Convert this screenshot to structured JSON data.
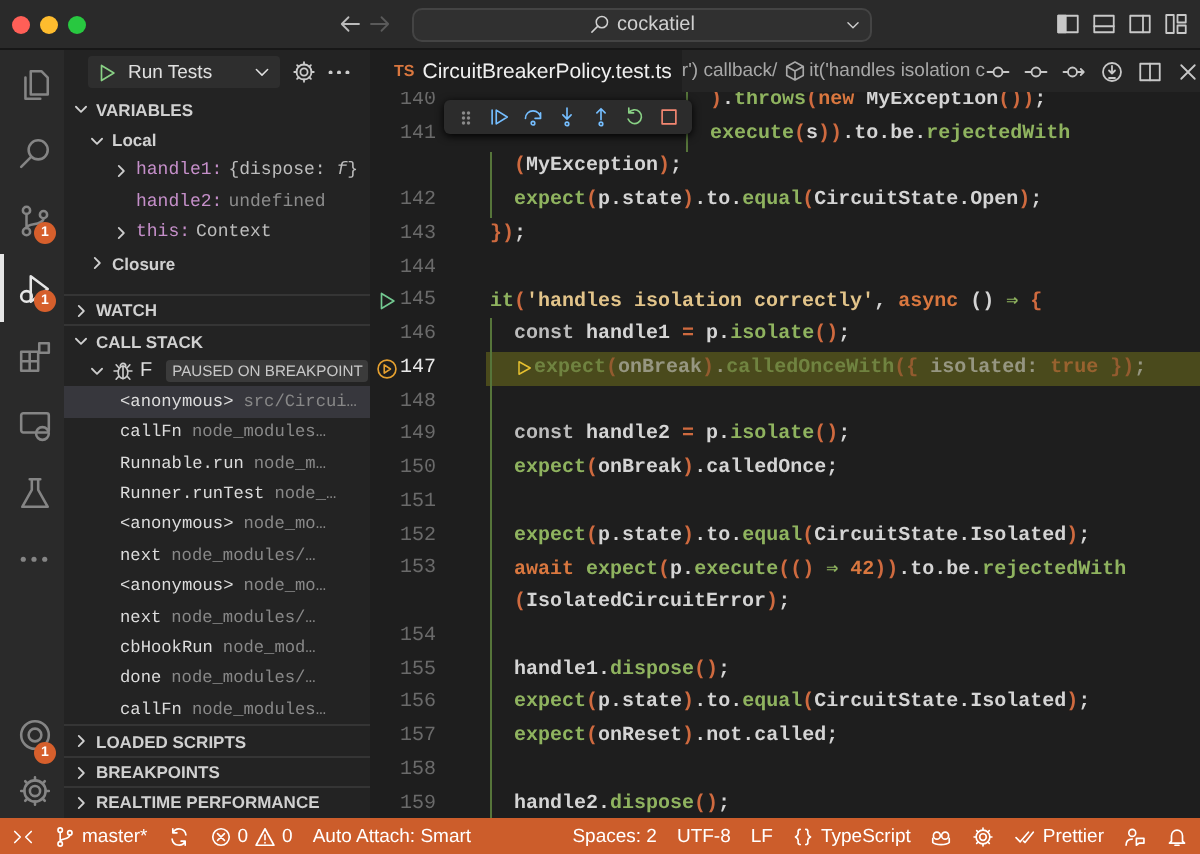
{
  "window": {
    "title": "cockatiel"
  },
  "activity_bar": {
    "items": [
      {
        "kind": "explorer",
        "selected": false
      },
      {
        "kind": "search",
        "selected": false
      },
      {
        "kind": "source-control",
        "selected": false,
        "badge": "1"
      },
      {
        "kind": "run-debug",
        "selected": true,
        "badge": "1"
      },
      {
        "kind": "extensions",
        "selected": false
      },
      {
        "kind": "remote",
        "selected": false
      },
      {
        "kind": "testing",
        "selected": false
      },
      {
        "kind": "more",
        "selected": false
      }
    ],
    "bottom": [
      {
        "kind": "accounts",
        "badge": "1"
      },
      {
        "kind": "settings"
      }
    ]
  },
  "debug": {
    "launch": "Run Tests",
    "variables": {
      "title": "VARIABLES",
      "expanded": true,
      "scopes": [
        {
          "name": "Local",
          "expanded": true,
          "children": [
            {
              "name": "handle1:",
              "value": "{dispose: *f*}",
              "expandable": true,
              "expanded": false
            },
            {
              "name": "handle2:",
              "value": "undefined",
              "expandable": false
            },
            {
              "name": "this:",
              "value": "Context",
              "expandable": true,
              "expanded": false
            }
          ]
        },
        {
          "name": "Closure",
          "expanded": false
        }
      ]
    },
    "watch": {
      "title": "WATCH",
      "expanded": false
    },
    "call_stack": {
      "title": "CALL STACK",
      "expanded": true,
      "thread": {
        "name": "F",
        "expanded": true,
        "status": "PAUSED ON BREAKPOINT"
      },
      "frames": [
        {
          "name": "<anonymous>",
          "source": "src/Circui…",
          "selected": true
        },
        {
          "name": "callFn",
          "source": "node_modules…",
          "selected": false
        },
        {
          "name": "Runnable.run",
          "source": "node_m…",
          "selected": false
        },
        {
          "name": "Runner.runTest",
          "source": "node_…",
          "selected": false
        },
        {
          "name": "<anonymous>",
          "source": "node_mo…",
          "selected": false
        },
        {
          "name": "next",
          "source": "node_modules/…",
          "selected": false
        },
        {
          "name": "<anonymous>",
          "source": "node_mo…",
          "selected": false
        },
        {
          "name": "next",
          "source": "node_modules/…",
          "selected": false
        },
        {
          "name": "cbHookRun",
          "source": "node_mod…",
          "selected": false
        },
        {
          "name": "done",
          "source": "node_modules/…",
          "selected": false
        },
        {
          "name": "callFn",
          "source": "node_modules…",
          "selected": false
        }
      ]
    },
    "more_sections": [
      {
        "title": "LOADED SCRIPTS",
        "expanded": false
      },
      {
        "title": "BREAKPOINTS",
        "expanded": false
      },
      {
        "title": "REALTIME PERFORMANCE",
        "expanded": false
      }
    ]
  },
  "editor": {
    "tab": {
      "badge": "TS",
      "name": "CircuitBreakerPolicy.test.ts"
    },
    "breadcrumbs": [
      {
        "kind": "plain",
        "text": "r') callback/"
      },
      {
        "kind": "method",
        "text": "it('handles isolation c"
      }
    ],
    "lines": [
      {
        "number": "140",
        "partial": true,
        "indented": true,
        "current": false,
        "tokens": [
          {
            "text": ")",
            "kind": "bracket"
          },
          {
            "text": ".",
            "kind": "plain"
          },
          {
            "text": "throws",
            "kind": "function"
          },
          {
            "text": "(",
            "kind": "bracket"
          },
          {
            "text": "new ",
            "kind": "keyword"
          },
          {
            "text": "MyException",
            "kind": "plain"
          },
          {
            "text": "()",
            "kind": "bracket"
          },
          {
            "text": ")",
            "kind": "bracket"
          },
          {
            "text": ";",
            "kind": "plain"
          }
        ]
      },
      {
        "number": "141",
        "partial": true,
        "indented": true,
        "current": false,
        "tokens": [
          {
            "text": "execute",
            "kind": "function"
          },
          {
            "text": "(",
            "kind": "bracket"
          },
          {
            "text": "s",
            "kind": "plain"
          },
          {
            "text": "))",
            "kind": "bracket"
          },
          {
            "text": ".to.be.",
            "kind": "plain"
          },
          {
            "text": "rejectedWith",
            "kind": "function"
          }
        ]
      },
      {
        "partial": false,
        "indented": true,
        "current": false,
        "tokens": [
          {
            "text": "(",
            "kind": "bracket"
          },
          {
            "text": "MyException",
            "kind": "plain"
          },
          {
            "text": ")",
            "kind": "bracket"
          },
          {
            "text": ";",
            "kind": "plain"
          }
        ]
      },
      {
        "number": "142",
        "partial": false,
        "indented": true,
        "current": false,
        "tokens": [
          {
            "text": "expect",
            "kind": "function"
          },
          {
            "text": "(",
            "kind": "bracket"
          },
          {
            "text": "p.state",
            "kind": "plain"
          },
          {
            "text": ")",
            "kind": "bracket"
          },
          {
            "text": ".to.",
            "kind": "plain"
          },
          {
            "text": "equal",
            "kind": "function"
          },
          {
            "text": "(",
            "kind": "bracket"
          },
          {
            "text": "CircuitState.Open",
            "kind": "plain"
          },
          {
            "text": ")",
            "kind": "bracket"
          },
          {
            "text": ";",
            "kind": "plain"
          }
        ]
      },
      {
        "number": "143",
        "partial": false,
        "indented": false,
        "current": false,
        "tokens": [
          {
            "text": "})",
            "kind": "bracket"
          },
          {
            "text": ";",
            "kind": "plain"
          }
        ]
      },
      {
        "number": "144",
        "indented": false,
        "current": false
      },
      {
        "number": "145",
        "gutter": {
          "kind": "run"
        },
        "partial": false,
        "indented": false,
        "current": false,
        "tokens": [
          {
            "text": "it",
            "kind": "function"
          },
          {
            "text": "(",
            "kind": "bracket"
          },
          {
            "text": "'handles isolation correctly'",
            "kind": "string"
          },
          {
            "text": ", ",
            "kind": "plain"
          },
          {
            "text": "async",
            "kind": "keyword"
          },
          {
            "text": " () ",
            "kind": "plain"
          },
          {
            "text": "⇒",
            "kind": "function"
          },
          {
            "text": " {",
            "kind": "bracket"
          }
        ]
      },
      {
        "number": "146",
        "partial": false,
        "indented": true,
        "current": false,
        "tokens": [
          {
            "text": "const",
            "kind": "dim"
          },
          {
            "text": " handle1 ",
            "kind": "plain"
          },
          {
            "text": "=",
            "kind": "bracket"
          },
          {
            "text": " p.",
            "kind": "plain"
          },
          {
            "text": "isolate",
            "kind": "function"
          },
          {
            "text": "()",
            "kind": "bracket"
          },
          {
            "text": ";",
            "kind": "plain"
          }
        ]
      },
      {
        "number": "147",
        "gutter": {
          "kind": "stack-frame"
        },
        "partial": false,
        "indented": true,
        "current": true,
        "tokens": [
          {
            "text": "expect",
            "kind": "function"
          },
          {
            "text": "(",
            "kind": "bracket"
          },
          {
            "text": "onBreak",
            "kind": "plain"
          },
          {
            "text": ")",
            "kind": "bracket"
          },
          {
            "text": ".",
            "kind": "plain"
          },
          {
            "text": "calledOnceWith",
            "kind": "function"
          },
          {
            "text": "({",
            "kind": "bracket"
          },
          {
            "text": " isolated: ",
            "kind": "plain"
          },
          {
            "text": "true",
            "kind": "keyword"
          },
          {
            "text": " })",
            "kind": "bracket"
          },
          {
            "text": ";",
            "kind": "plain"
          }
        ]
      },
      {
        "number": "148",
        "indented": true,
        "current": false
      },
      {
        "number": "149",
        "partial": false,
        "indented": true,
        "current": false,
        "tokens": [
          {
            "text": "const",
            "kind": "dim"
          },
          {
            "text": " handle2 ",
            "kind": "plain"
          },
          {
            "text": "=",
            "kind": "bracket"
          },
          {
            "text": " p.",
            "kind": "plain"
          },
          {
            "text": "isolate",
            "kind": "function"
          },
          {
            "text": "()",
            "kind": "bracket"
          },
          {
            "text": ";",
            "kind": "plain"
          }
        ]
      },
      {
        "number": "150",
        "partial": false,
        "indented": true,
        "current": false,
        "tokens": [
          {
            "text": "expect",
            "kind": "function"
          },
          {
            "text": "(",
            "kind": "bracket"
          },
          {
            "text": "onBreak",
            "kind": "plain"
          },
          {
            "text": ")",
            "kind": "bracket"
          },
          {
            "text": ".calledOnce;",
            "kind": "plain"
          }
        ]
      },
      {
        "number": "151",
        "indented": true,
        "current": false
      },
      {
        "number": "152",
        "partial": false,
        "indented": true,
        "current": false,
        "tokens": [
          {
            "text": "expect",
            "kind": "function"
          },
          {
            "text": "(",
            "kind": "bracket"
          },
          {
            "text": "p.state",
            "kind": "plain"
          },
          {
            "text": ")",
            "kind": "bracket"
          },
          {
            "text": ".to.",
            "kind": "plain"
          },
          {
            "text": "equal",
            "kind": "function"
          },
          {
            "text": "(",
            "kind": "bracket"
          },
          {
            "text": "CircuitState.Isolated",
            "kind": "plain"
          },
          {
            "text": ")",
            "kind": "bracket"
          },
          {
            "text": ";",
            "kind": "plain"
          }
        ]
      },
      {
        "number": "153",
        "partial": false,
        "indented": true,
        "current": false,
        "tokens": [
          {
            "text": "await ",
            "kind": "keyword"
          },
          {
            "text": "expect",
            "kind": "function"
          },
          {
            "text": "(",
            "kind": "bracket"
          },
          {
            "text": "p.",
            "kind": "plain"
          },
          {
            "text": "execute",
            "kind": "function"
          },
          {
            "text": "(() ",
            "kind": "bracket"
          },
          {
            "text": "⇒",
            "kind": "function"
          },
          {
            "text": " 42",
            "kind": "keyword"
          },
          {
            "text": "))",
            "kind": "bracket"
          },
          {
            "text": ".to.be.",
            "kind": "plain"
          },
          {
            "text": "rejectedWith",
            "kind": "function"
          }
        ]
      },
      {
        "partial": false,
        "indented": true,
        "current": false,
        "tokens": [
          {
            "text": "(",
            "kind": "bracket"
          },
          {
            "text": "IsolatedCircuitError",
            "kind": "plain"
          },
          {
            "text": ")",
            "kind": "bracket"
          },
          {
            "text": ";",
            "kind": "plain"
          }
        ]
      },
      {
        "number": "154",
        "indented": true,
        "current": false
      },
      {
        "number": "155",
        "partial": false,
        "indented": true,
        "current": false,
        "tokens": [
          {
            "text": "handle1.",
            "kind": "plain"
          },
          {
            "text": "dispose",
            "kind": "function"
          },
          {
            "text": "()",
            "kind": "bracket"
          },
          {
            "text": ";",
            "kind": "plain"
          }
        ]
      },
      {
        "number": "156",
        "partial": false,
        "indented": true,
        "current": false,
        "tokens": [
          {
            "text": "expect",
            "kind": "function"
          },
          {
            "text": "(",
            "kind": "bracket"
          },
          {
            "text": "p.state",
            "kind": "plain"
          },
          {
            "text": ")",
            "kind": "bracket"
          },
          {
            "text": ".to.",
            "kind": "plain"
          },
          {
            "text": "equal",
            "kind": "function"
          },
          {
            "text": "(",
            "kind": "bracket"
          },
          {
            "text": "CircuitState.Isolated",
            "kind": "plain"
          },
          {
            "text": ")",
            "kind": "bracket"
          },
          {
            "text": ";",
            "kind": "plain"
          }
        ]
      },
      {
        "number": "157",
        "partial": false,
        "indented": true,
        "current": false,
        "tokens": [
          {
            "text": "expect",
            "kind": "function"
          },
          {
            "text": "(",
            "kind": "bracket"
          },
          {
            "text": "onReset",
            "kind": "plain"
          },
          {
            "text": ")",
            "kind": "bracket"
          },
          {
            "text": ".not.called;",
            "kind": "plain"
          }
        ]
      },
      {
        "number": "158",
        "indented": true,
        "current": false
      },
      {
        "number": "159",
        "partial": false,
        "indented": true,
        "current": false,
        "tokens": [
          {
            "text": "handle2.",
            "kind": "plain"
          },
          {
            "text": "dispose",
            "kind": "function"
          },
          {
            "text": "()",
            "kind": "bracket"
          },
          {
            "text": ";",
            "kind": "plain"
          }
        ]
      }
    ]
  },
  "status_bar": {
    "left": [
      {
        "kind": "remote"
      },
      {
        "kind": "branch",
        "text": "master*"
      },
      {
        "kind": "sync"
      },
      {
        "kind": "problems",
        "errors": "0",
        "warnings": "0"
      },
      {
        "kind": "text",
        "text": "Auto Attach: Smart"
      }
    ],
    "right": [
      {
        "kind": "text",
        "text": "Spaces: 2"
      },
      {
        "kind": "text",
        "text": "UTF-8"
      },
      {
        "kind": "text",
        "text": "LF"
      },
      {
        "kind": "language",
        "text": "TypeScript"
      },
      {
        "kind": "copilot"
      },
      {
        "kind": "settings-sync"
      },
      {
        "kind": "prettier",
        "text": "Prettier"
      },
      {
        "kind": "feedback"
      },
      {
        "kind": "bell"
      }
    ]
  }
}
